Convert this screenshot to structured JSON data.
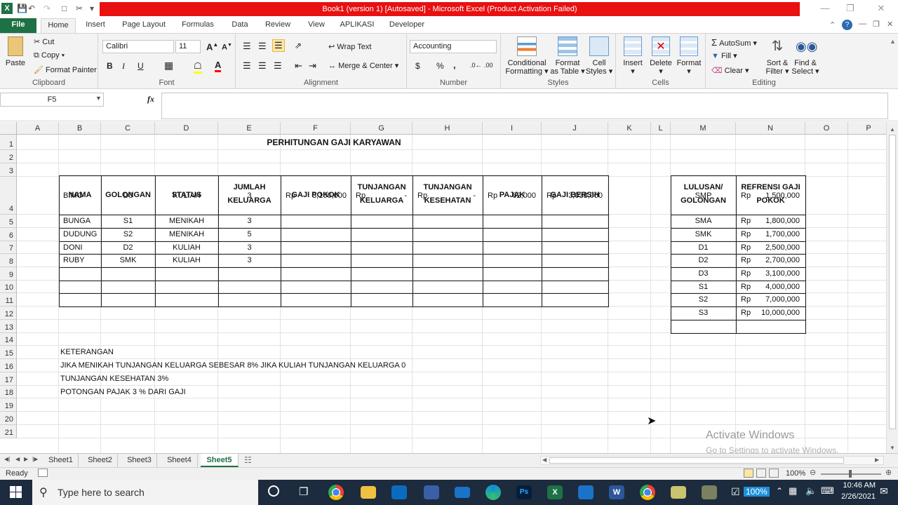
{
  "window": {
    "title": "Book1 (version 1) [Autosaved] - Microsoft Excel (Product Activation Failed)",
    "app_icon": "X"
  },
  "tabs": [
    "File",
    "Home",
    "Insert",
    "Page Layout",
    "Formulas",
    "Data",
    "Review",
    "View",
    "APLIKASI",
    "Developer"
  ],
  "ribbon": {
    "clipboard": {
      "paste": "Paste",
      "cut": "Cut",
      "copy": "Copy",
      "format_painter": "Format Painter",
      "label": "Clipboard"
    },
    "font": {
      "name": "Calibri",
      "size": "11",
      "bold": "B",
      "italic": "I",
      "underline": "U",
      "label": "Font"
    },
    "alignment": {
      "wrap_text": "Wrap Text",
      "merge_center": "Merge & Center",
      "label": "Alignment"
    },
    "number": {
      "format": "Accounting",
      "currency": "$",
      "percent": "%",
      "comma": ",",
      "label": "Number"
    },
    "styles": {
      "conditional": "Conditional",
      "conditional2": "Formatting",
      "format_table": "Format",
      "format_table2": "as Table",
      "cell_styles": "Cell",
      "cell_styles2": "Styles",
      "label": "Styles"
    },
    "cells": {
      "insert": "Insert",
      "delete": "Delete",
      "format": "Format",
      "label": "Cells"
    },
    "editing": {
      "autosum": "AutoSum",
      "fill": "Fill",
      "clear": "Clear",
      "sort": "Sort &",
      "sort2": "Filter",
      "find": "Find &",
      "find2": "Select",
      "label": "Editing"
    }
  },
  "formula_bar": {
    "name_box": "F5",
    "fx": "fx",
    "value": ""
  },
  "columns": [
    "A",
    "B",
    "C",
    "D",
    "E",
    "F",
    "G",
    "H",
    "I",
    "J",
    "K",
    "L",
    "M",
    "N",
    "O",
    "P"
  ],
  "rows": [
    "1",
    "2",
    "3",
    "4",
    "5",
    "6",
    "7",
    "8",
    "9",
    "10",
    "11",
    "12",
    "13",
    "14",
    "15",
    "16",
    "17",
    "18",
    "19",
    "20",
    "21"
  ],
  "sheet": {
    "title": "PERHITUNGAN GAJI KARYAWAN",
    "headers": {
      "nama": "NAMA",
      "golongan": "GOLONGAN",
      "status": "STATUS",
      "jumlah1": "JUMLAH",
      "jumlah2": "KELUARGA",
      "gaji_pokok": "GAJI POKOK",
      "tk1": "TUNJANGAN",
      "tk2": "KELUARGA",
      "tks1": "TUNJANGAN",
      "tks2": "KESEHATAN",
      "pajak": "PAJAK",
      "gaji_bersih": "GAJI BERSIH"
    },
    "employees": [
      {
        "nama": "BIMO",
        "golongan": "D3",
        "status": "KULIAH",
        "jumlah": "3",
        "rp_gp": "Rp",
        "gaji_pokok": "3,100,000",
        "rp_tk": "Rp",
        "tk": "-",
        "rp_tks": "Rp",
        "tks": "-",
        "rp_pajak": "Rp",
        "pajak": "62,000",
        "rp_gb": "Rp",
        "gaji_bersih": "3,038,000"
      },
      {
        "nama": "BUNGA",
        "golongan": "S1",
        "status": "MENIKAH",
        "jumlah": "3"
      },
      {
        "nama": "DUDUNG",
        "golongan": "S2",
        "status": "MENIKAH",
        "jumlah": "5"
      },
      {
        "nama": "DONI",
        "golongan": "D2",
        "status": "KULIAH",
        "jumlah": "3"
      },
      {
        "nama": "RUBY",
        "golongan": "SMK",
        "status": "KULIAH",
        "jumlah": "3"
      }
    ],
    "ref_headers": {
      "l1": "LULUSAN/",
      "l2": "GOLONGAN",
      "r1": "REFRENSI GAJI",
      "r2": "POKOK"
    },
    "reference": [
      {
        "gol": "SMP",
        "rp": "Rp",
        "val": "1,500,000"
      },
      {
        "gol": "SMA",
        "rp": "Rp",
        "val": "1,800,000"
      },
      {
        "gol": "SMK",
        "rp": "Rp",
        "val": "1,700,000"
      },
      {
        "gol": "D1",
        "rp": "Rp",
        "val": "2,500,000"
      },
      {
        "gol": "D2",
        "rp": "Rp",
        "val": "2,700,000"
      },
      {
        "gol": "D3",
        "rp": "Rp",
        "val": "3,100,000"
      },
      {
        "gol": "S1",
        "rp": "Rp",
        "val": "4,000,000"
      },
      {
        "gol": "S2",
        "rp": "Rp",
        "val": "7,000,000"
      },
      {
        "gol": "S3",
        "rp": "Rp",
        "val": "10,000,000"
      }
    ],
    "notes": [
      "KETERANGAN",
      "JIKA MENIKAH TUNJANGAN KELUARGA SEBESAR 8% JIKA KULIAH TUNJANGAN KELUARGA 0",
      "TUNJANGAN KESEHATAN  3%",
      "POTONGAN PAJAK 3 % DARI GAJI"
    ]
  },
  "sheet_tabs": [
    "Sheet1",
    "Sheet2",
    "Sheet3",
    "Sheet4",
    "Sheet5"
  ],
  "status": {
    "ready": "Ready",
    "zoom": "100%"
  },
  "watermark": {
    "line1": "Activate Windows",
    "line2": "Go to Settings to activate Windows."
  },
  "taskbar": {
    "search": "Type here to search",
    "time": "10:46 AM",
    "date": "2/26/2021",
    "battery": "100%"
  }
}
